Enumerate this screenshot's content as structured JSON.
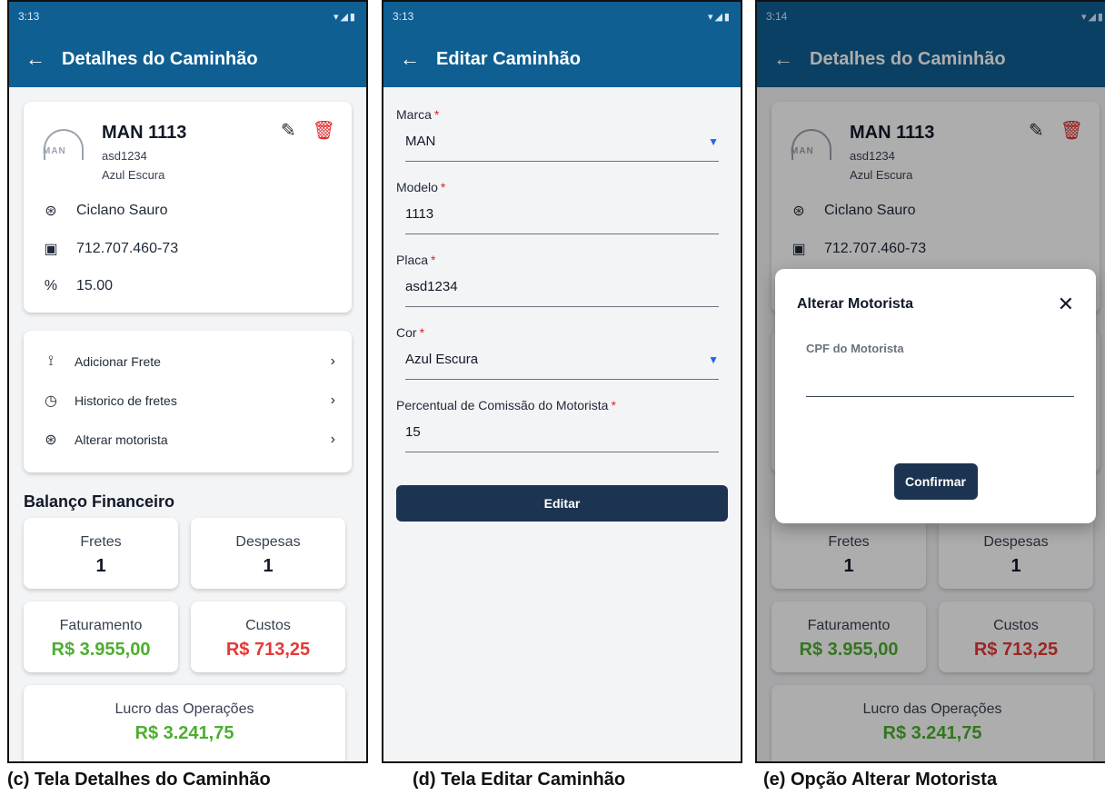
{
  "screen_c": {
    "status_time": "3:13",
    "status_icons": "▾◢▮",
    "title": "Detalhes do Caminhão",
    "truck": {
      "brand_logo": "MAN",
      "name": "MAN 1113",
      "plate": "asd1234",
      "color": "Azul Escura"
    },
    "driver_name": "Ciclano Sauro",
    "driver_cpf": "712.707.460-73",
    "commission": "15.00",
    "menu": [
      {
        "label": "Adicionar Frete",
        "icon": "route-icon"
      },
      {
        "label": "Historico de fretes",
        "icon": "clock-icon"
      },
      {
        "label": "Alterar motorista",
        "icon": "steering-wheel-icon"
      }
    ],
    "section_title": "Balanço Financeiro",
    "stats": {
      "fretes_label": "Fretes",
      "fretes_value": "1",
      "despesas_label": "Despesas",
      "despesas_value": "1",
      "faturamento_label": "Faturamento",
      "faturamento_value": "R$ 3.955,00",
      "custos_label": "Custos",
      "custos_value": "R$ 713,25",
      "lucro_label": "Lucro das Operações",
      "lucro_value": "R$ 3.241,75"
    },
    "colors": {
      "appbar": "#0f5f92",
      "positive": "#4caf2f",
      "negative": "#e53935",
      "delete": "#dc2626"
    }
  },
  "screen_d": {
    "status_time": "3:13",
    "status_icons": "▾◢▮",
    "title": "Editar Caminhão",
    "fields": [
      {
        "label": "Marca",
        "value": "MAN",
        "type": "select"
      },
      {
        "label": "Modelo",
        "value": "1113",
        "type": "text"
      },
      {
        "label": "Placa",
        "value": "asd1234",
        "type": "text"
      },
      {
        "label": "Cor",
        "value": "Azul Escura",
        "type": "select"
      },
      {
        "label": "Percentual de Comissão do Motorista",
        "value": "15",
        "type": "text"
      }
    ],
    "required_mark": "*",
    "submit_label": "Editar",
    "colors": {
      "button": "#1c3451"
    }
  },
  "screen_e": {
    "status_time": "3:14",
    "status_icons": "▾◢▮",
    "modal": {
      "title": "Alterar Motorista",
      "field_label": "CPF do Motorista",
      "field_value": "",
      "confirm_label": "Confirmar"
    }
  },
  "captions": {
    "c": "(c) Tela Detalhes do Caminhão",
    "d": "(d) Tela Editar Caminhão",
    "e": "(e) Opção Alterar Motorista"
  }
}
